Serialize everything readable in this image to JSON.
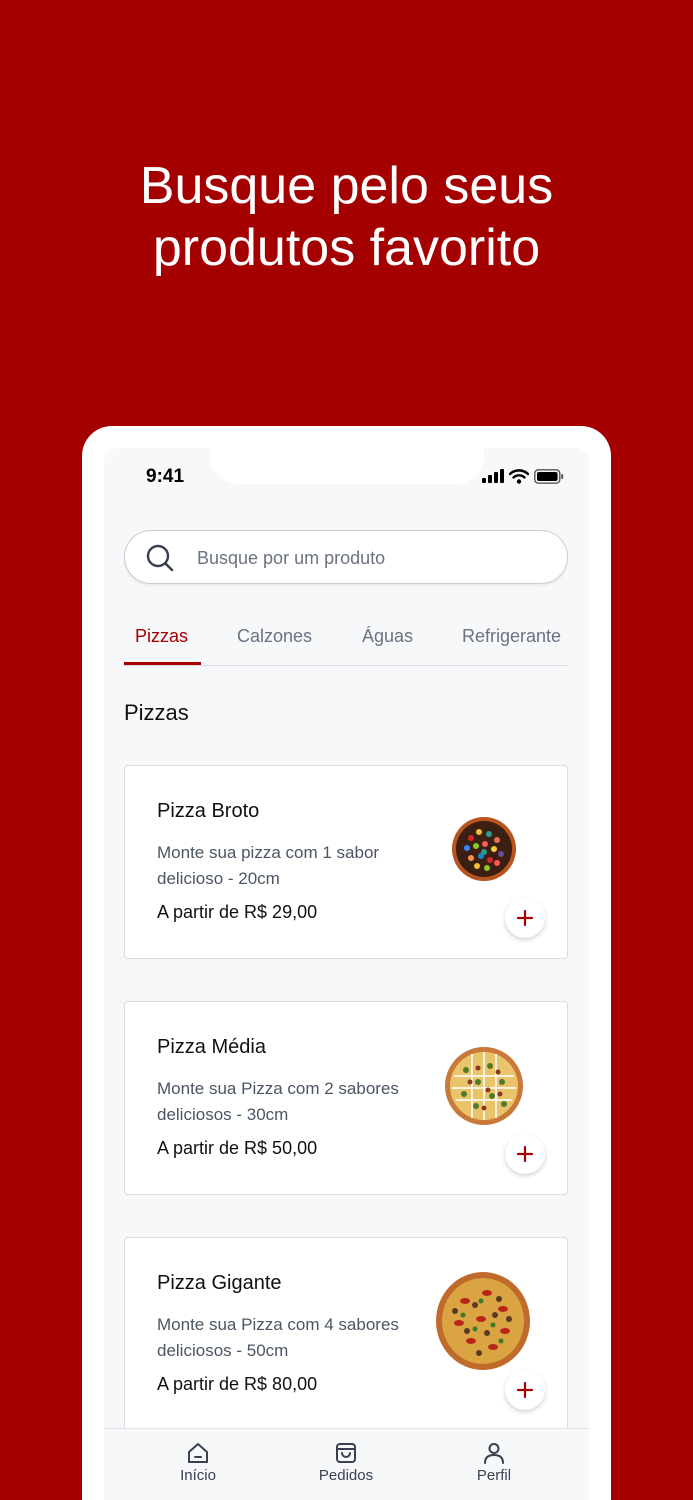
{
  "headline": {
    "line1": "Busque pelo seus",
    "line2": "produtos favorito"
  },
  "status_bar": {
    "time": "9:41"
  },
  "search": {
    "placeholder": "Busque por um produto"
  },
  "tabs": [
    {
      "label": "Pizzas",
      "active": true
    },
    {
      "label": "Calzones",
      "active": false
    },
    {
      "label": "Águas",
      "active": false
    },
    {
      "label": "Refrigerante",
      "active": false
    }
  ],
  "section": {
    "title": "Pizzas"
  },
  "products": [
    {
      "name": "Pizza Broto",
      "description": "Monte sua pizza com 1 sabor delicioso - 20cm",
      "price": "A partir de R$ 29,00",
      "image": "pizza-broto-image"
    },
    {
      "name": "Pizza Média",
      "description": "Monte sua Pizza com 2 sabores deliciosos - 30cm",
      "price": "A partir de R$ 50,00",
      "image": "pizza-media-image"
    },
    {
      "name": "Pizza Gigante",
      "description": "Monte sua Pizza com 4 sabores deliciosos - 50cm",
      "price": "A partir de R$ 80,00",
      "image": "pizza-gigante-image"
    }
  ],
  "bottom_nav": [
    {
      "label": "Início",
      "icon": "home-icon"
    },
    {
      "label": "Pedidos",
      "icon": "shopping-bag-icon"
    },
    {
      "label": "Perfil",
      "icon": "user-icon"
    }
  ],
  "colors": {
    "brand": "#a50000",
    "background": "#f7f8fa",
    "add_icon": "#a50000"
  }
}
